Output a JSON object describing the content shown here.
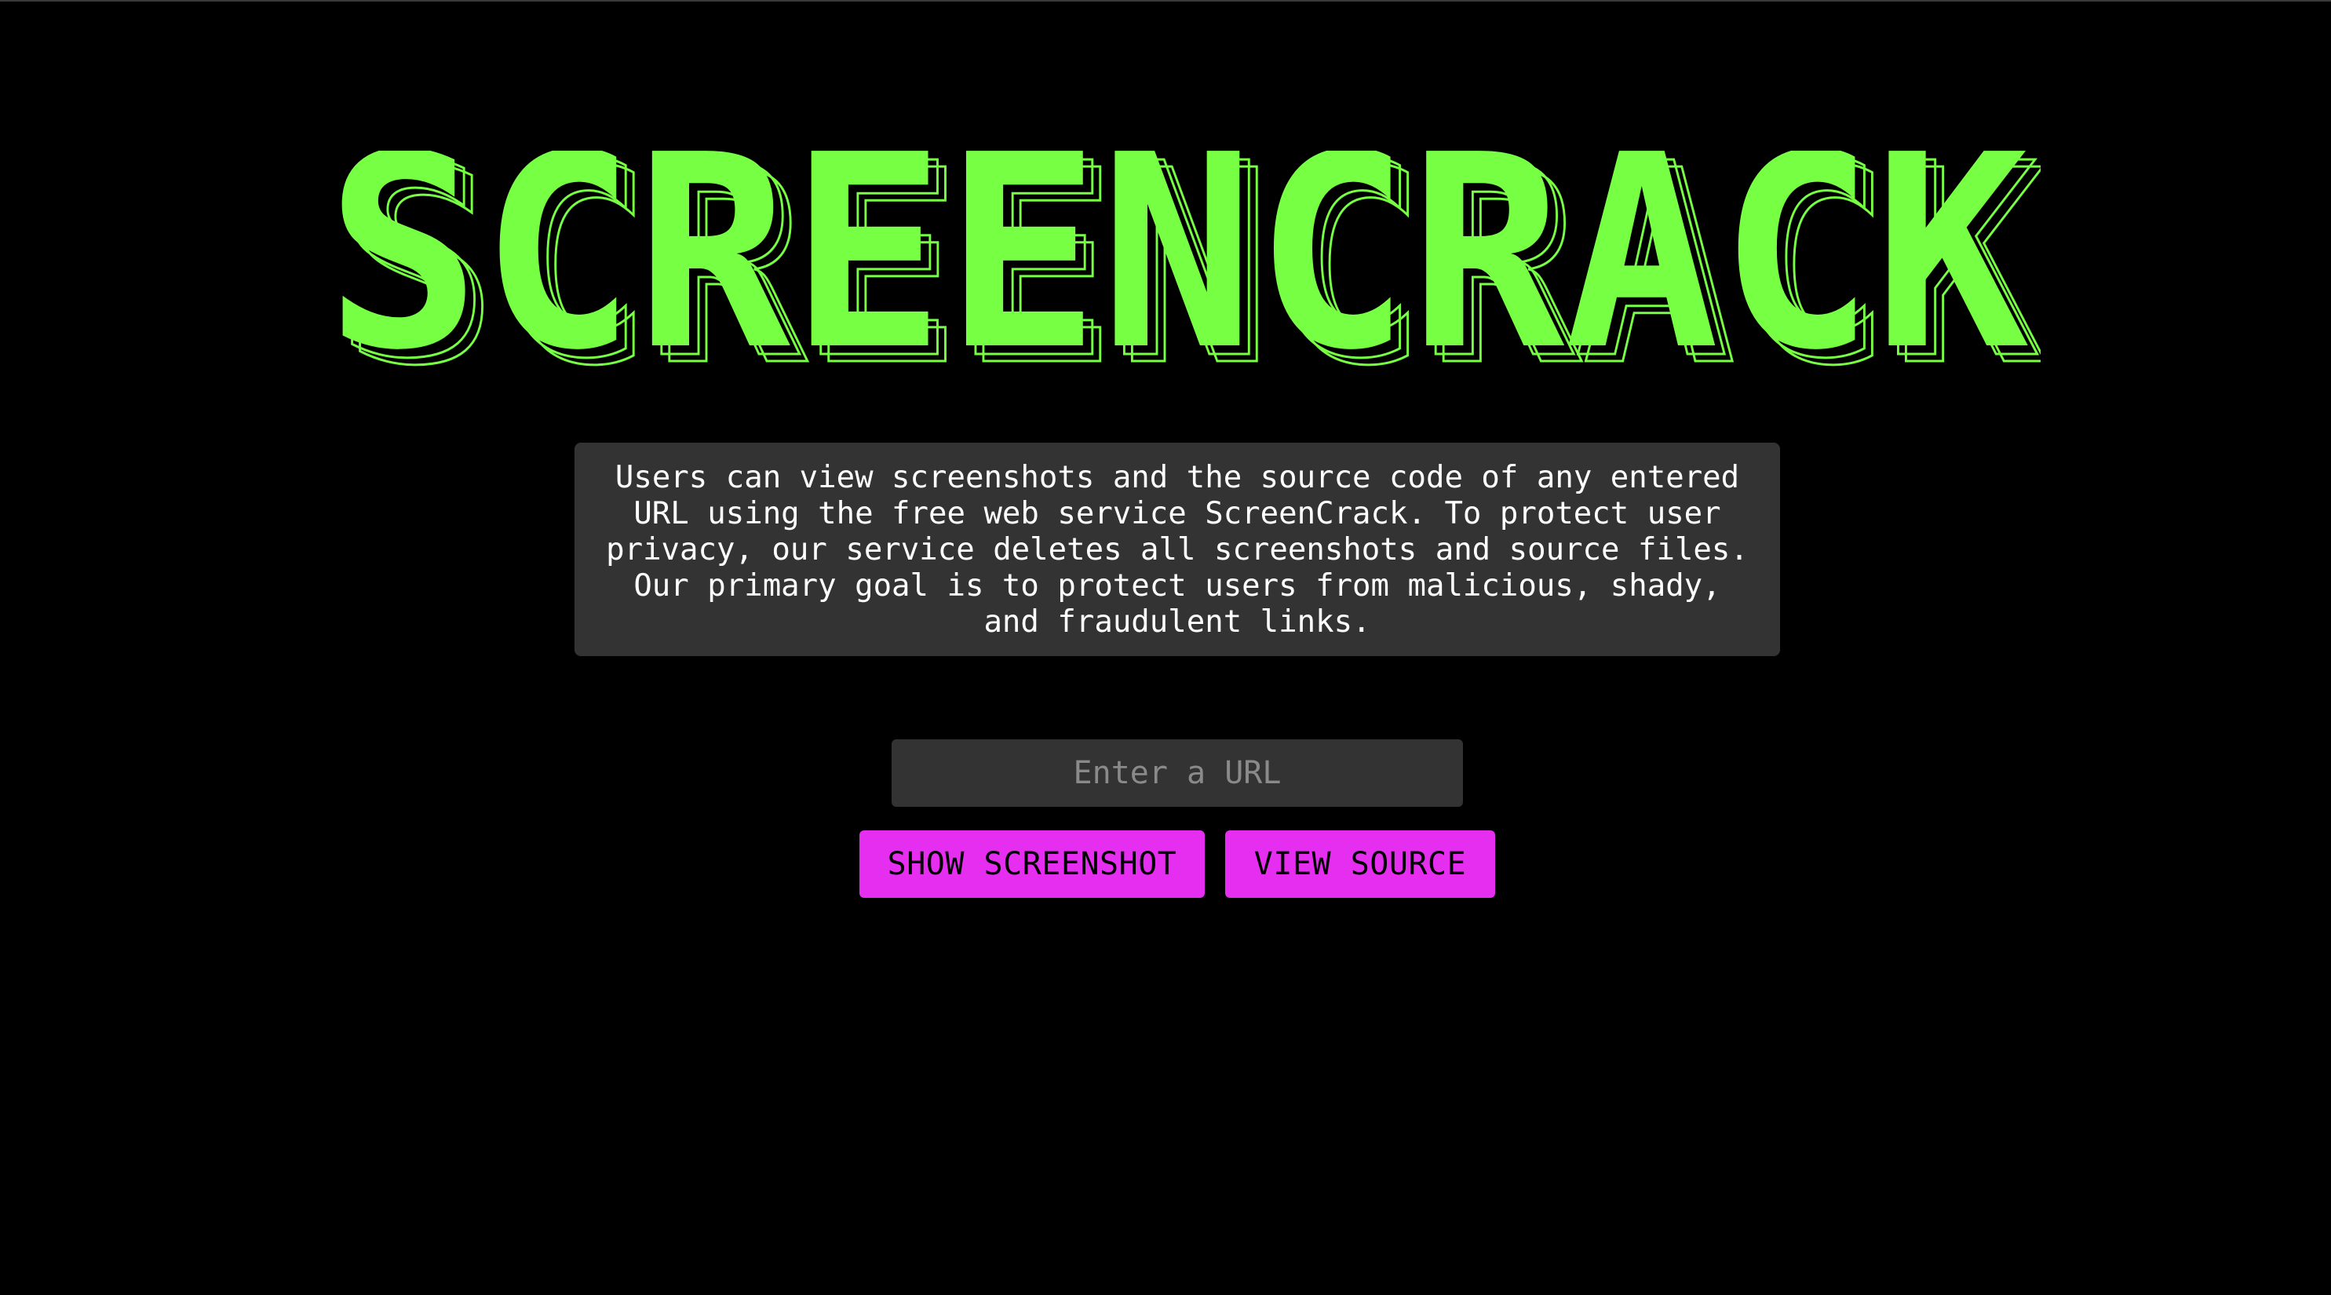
{
  "header": {
    "logo_text": "SCREENCRACK"
  },
  "description": {
    "text": "Users can view screenshots and the source code of any entered\nURL using the free web service ScreenCrack. To protect user\nprivacy, our service deletes all screenshots and source files.\nOur primary goal is to protect users from malicious, shady,\nand fraudulent links."
  },
  "form": {
    "url_placeholder": "Enter a URL",
    "url_value": "",
    "show_screenshot_label": "SHOW SCREENSHOT",
    "view_source_label": "VIEW SOURCE"
  },
  "colors": {
    "background": "#000000",
    "logo_green": "#77ff44",
    "panel": "#333333",
    "button_magenta": "#e62ef0"
  },
  "icons": {
    "logo": "ascii-block-art-wordmark"
  }
}
